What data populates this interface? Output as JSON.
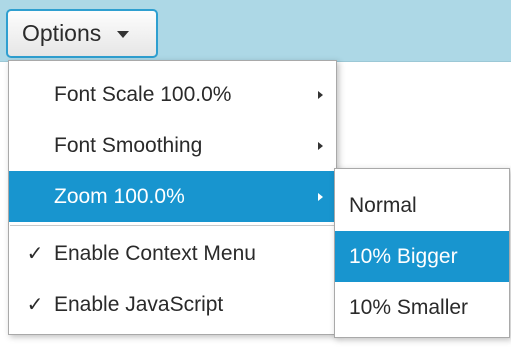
{
  "toolbar": {
    "options_label": "Options"
  },
  "menu": {
    "items": [
      {
        "label": "Font Scale 100.0%",
        "checked": false,
        "has_submenu": true
      },
      {
        "label": "Font Smoothing",
        "checked": false,
        "has_submenu": true
      },
      {
        "label": "Zoom 100.0%",
        "checked": false,
        "has_submenu": true,
        "highlighted": true
      },
      {
        "label": "Enable Context Menu",
        "checked": true,
        "check_glyph": "✓"
      },
      {
        "label": "Enable JavaScript",
        "checked": true,
        "check_glyph": "✓"
      }
    ]
  },
  "zoom_submenu": {
    "items": [
      {
        "label": "Normal"
      },
      {
        "label": "10% Bigger",
        "highlighted": true
      },
      {
        "label": "10% Smaller"
      }
    ]
  },
  "colors": {
    "app_bar": "#add8e6",
    "highlight": "#1895cf",
    "button_border": "#2e9fd0"
  }
}
